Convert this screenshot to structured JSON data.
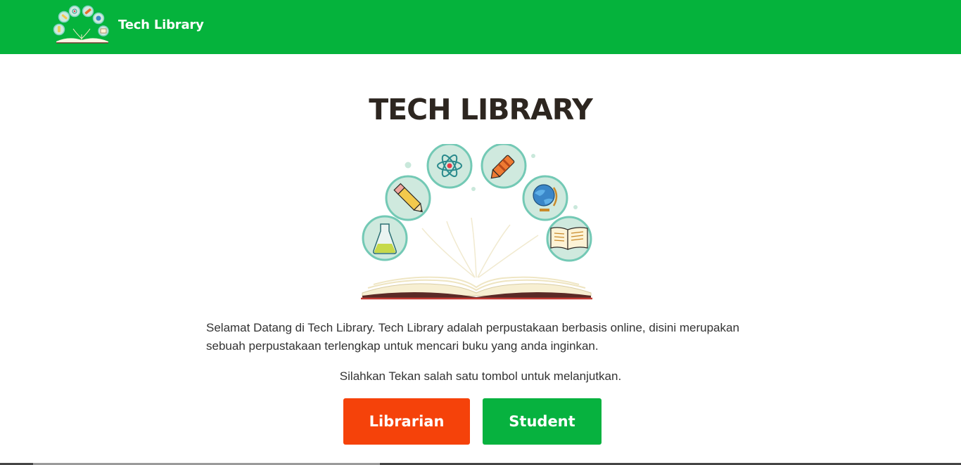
{
  "navbar": {
    "brand_name": "Tech Library",
    "brand_logo_icon": "book-with-subject-icons-logo",
    "background_color": "#05b33c"
  },
  "main": {
    "title": "TECH LIBRARY",
    "hero_illustration": "open-book-with-subject-icons",
    "intro_text": "Selamat Datang di Tech Library. Tech Library adalah perpustakaan berbasis online, disini merupakan sebuah perpustakaan terlengkap untuk mencari buku yang anda inginkan.",
    "prompt_text": "Silahkan Tekan salah satu tombol untuk melanjutkan.",
    "buttons": {
      "librarian": {
        "label": "Librarian",
        "color": "#f5420a"
      },
      "student": {
        "label": "Student",
        "color": "#07b23f"
      }
    }
  }
}
